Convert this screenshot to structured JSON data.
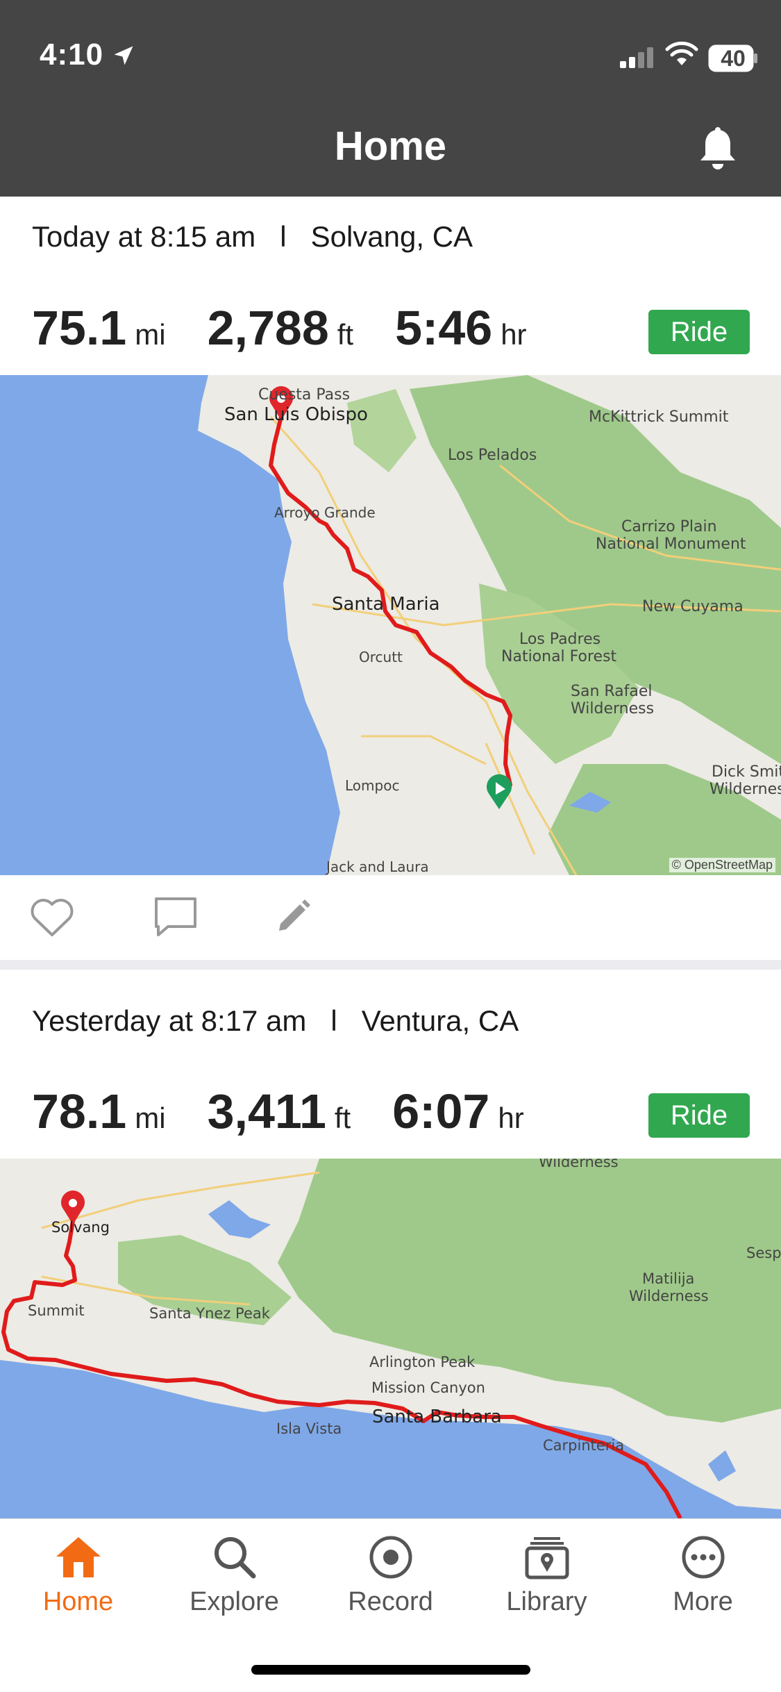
{
  "status_bar": {
    "time": "4:10",
    "battery": "40"
  },
  "header": {
    "title": "Home"
  },
  "activities": [
    {
      "when": "Today at 8:15 am",
      "separator": "l",
      "location": "Solvang, CA",
      "distance": "75.1",
      "distance_unit": "mi",
      "elevation": "2,788",
      "elevation_unit": "ft",
      "duration": "5:46",
      "duration_unit": "hr",
      "type": "Ride",
      "map_labels": [
        "Cuesta Pass",
        "San Luis Obispo",
        "McKittrick Summit",
        "Los Pelados",
        "Arroyo Grande",
        "Carrizo Plain",
        "National Monument",
        "Santa Maria",
        "New Cuyama",
        "Los Padres",
        "National Forest",
        "Orcutt",
        "San Rafael",
        "Wilderness",
        "Lompoc",
        "Dick Smit",
        "Wildernes",
        "Jack and Laura"
      ],
      "map_credit": "© OpenStreetMap"
    },
    {
      "when": "Yesterday at 8:17 am",
      "separator": "l",
      "location": "Ventura, CA",
      "distance": "78.1",
      "distance_unit": "mi",
      "elevation": "3,411",
      "elevation_unit": "ft",
      "duration": "6:07",
      "duration_unit": "hr",
      "type": "Ride",
      "map_labels": [
        "Wilderness",
        "Solvang",
        "Sesp",
        "Matilija",
        "Wilderness",
        "Summit",
        "Santa Ynez Peak",
        "Arlington Peak",
        "Mission Canyon",
        "Isla Vista",
        "Santa Barbara",
        "Carpinteria"
      ]
    }
  ],
  "tabs": [
    {
      "label": "Home",
      "icon": "home-icon",
      "active": true
    },
    {
      "label": "Explore",
      "icon": "search-icon",
      "active": false
    },
    {
      "label": "Record",
      "icon": "record-icon",
      "active": false
    },
    {
      "label": "Library",
      "icon": "library-icon",
      "active": false
    },
    {
      "label": "More",
      "icon": "more-icon",
      "active": false
    }
  ],
  "colors": {
    "accent": "#f26b14",
    "ride_badge": "#31a84f",
    "route": "#e01b1b",
    "header_bg": "#454545",
    "ocean": "#7fa8e8",
    "forest": "#9fc98a"
  }
}
